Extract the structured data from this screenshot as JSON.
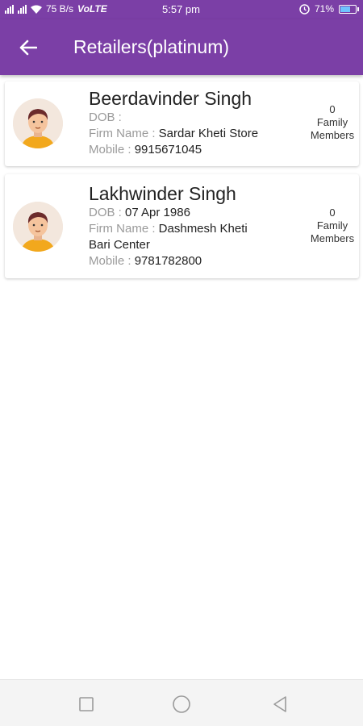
{
  "status_bar": {
    "speed": "75 B/s",
    "network": "VoLTE",
    "time": "5:57 pm",
    "battery": "71%",
    "battery_level": 0.71
  },
  "app_bar": {
    "title": "Retailers(platinum)"
  },
  "retailers": [
    {
      "name": "Beerdavinder Singh",
      "dob_label": "DOB :",
      "dob": "",
      "firm_label": "Firm Name :",
      "firm": "Sardar Kheti Store",
      "firm_cont": "",
      "mobile_label": "Mobile :",
      "mobile": "9915671045",
      "family_count": "0",
      "family_label_1": "Family",
      "family_label_2": "Members"
    },
    {
      "name": "Lakhwinder Singh",
      "dob_label": "DOB :",
      "dob": "07 Apr 1986",
      "firm_label": "Firm Name :",
      "firm": "Dashmesh Kheti",
      "firm_cont": "Bari Center",
      "mobile_label": "Mobile :",
      "mobile": "9781782800",
      "family_count": "0",
      "family_label_1": "Family",
      "family_label_2": "Members"
    }
  ],
  "colors": {
    "primary": "#7b3fa6",
    "label_gray": "#9a9a9a"
  }
}
